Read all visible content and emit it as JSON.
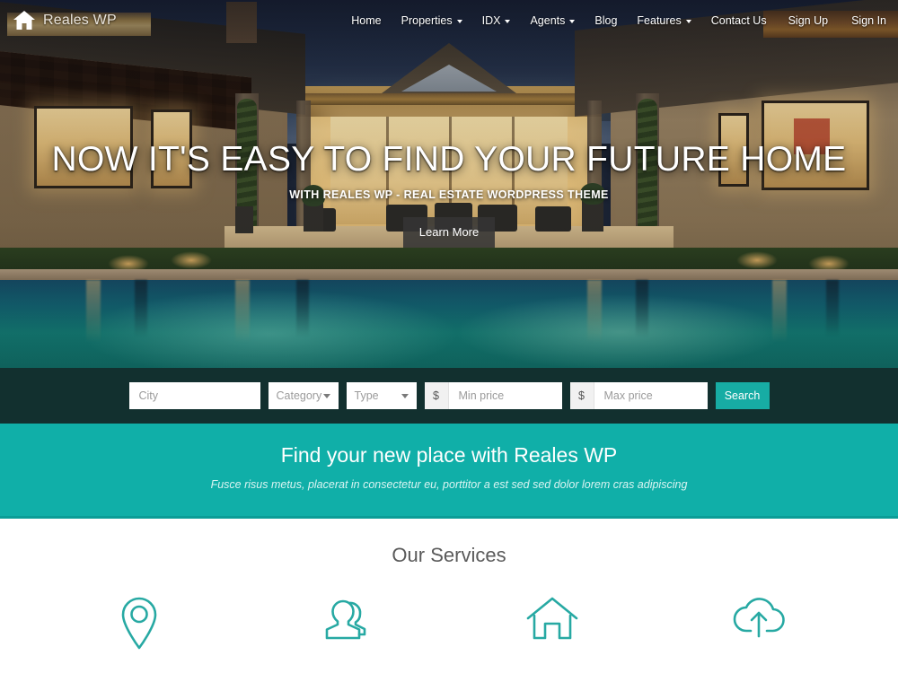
{
  "brand": {
    "name": "Reales WP",
    "icon": "home-icon"
  },
  "nav": {
    "items": [
      {
        "label": "Home",
        "has_dropdown": false
      },
      {
        "label": "Properties",
        "has_dropdown": true
      },
      {
        "label": "IDX",
        "has_dropdown": true
      },
      {
        "label": "Agents",
        "has_dropdown": true
      },
      {
        "label": "Blog",
        "has_dropdown": false
      },
      {
        "label": "Features",
        "has_dropdown": true
      },
      {
        "label": "Contact Us",
        "has_dropdown": false
      }
    ],
    "auth": [
      {
        "label": "Sign Up"
      },
      {
        "label": "Sign In"
      }
    ]
  },
  "hero": {
    "title": "NOW IT'S EASY TO FIND YOUR FUTURE HOME",
    "subtitle": "WITH REALES WP - REAL ESTATE WORDPRESS THEME",
    "button": "Learn More"
  },
  "search": {
    "city_placeholder": "City",
    "city_value": "",
    "category_label": "Category",
    "type_label": "Type",
    "currency_symbol": "$",
    "min_price_placeholder": "Min price",
    "min_price_value": "",
    "max_price_placeholder": "Max price",
    "max_price_value": "",
    "search_button": "Search"
  },
  "banner": {
    "title": "Find your new place with Reales WP",
    "subtitle": "Fusce risus metus, placerat in consectetur eu, porttitor a est sed sed dolor lorem cras adipiscing"
  },
  "services": {
    "title": "Our Services",
    "items": [
      {
        "icon": "map-pin-icon"
      },
      {
        "icon": "users-icon"
      },
      {
        "icon": "home-outline-icon"
      },
      {
        "icon": "cloud-upload-icon"
      }
    ]
  },
  "colors": {
    "teal": "#10afa8",
    "teal_button": "#17aca4",
    "search_band": "#12302f",
    "teal_border": "#0b9d97"
  }
}
